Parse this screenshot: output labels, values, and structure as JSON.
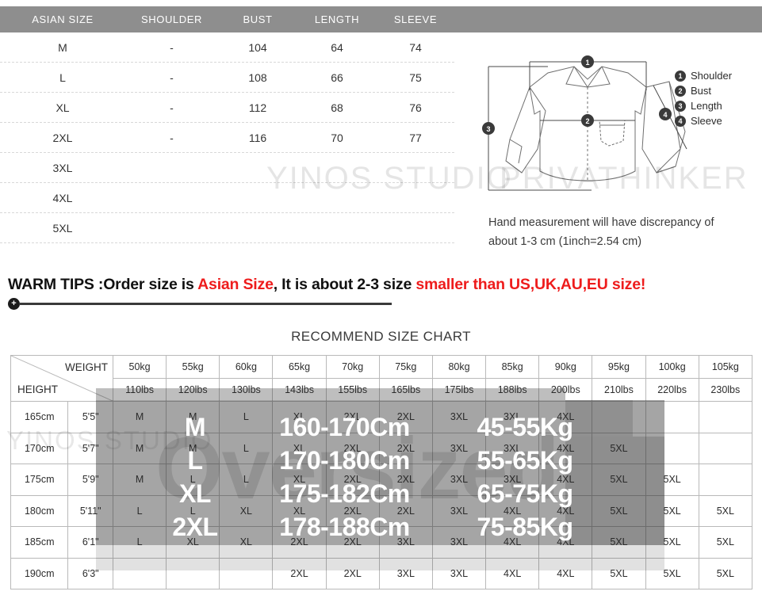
{
  "spec_table": {
    "headers": [
      "ASIAN SIZE",
      "SHOULDER",
      "BUST",
      "LENGTH",
      "SLEEVE"
    ],
    "rows": [
      {
        "size": "M",
        "shoulder": "-",
        "bust": "104",
        "length": "64",
        "sleeve": "74"
      },
      {
        "size": "L",
        "shoulder": "-",
        "bust": "108",
        "length": "66",
        "sleeve": "75"
      },
      {
        "size": "XL",
        "shoulder": "-",
        "bust": "112",
        "length": "68",
        "sleeve": "76"
      },
      {
        "size": "2XL",
        "shoulder": "-",
        "bust": "116",
        "length": "70",
        "sleeve": "77"
      },
      {
        "size": "3XL",
        "shoulder": "",
        "bust": "",
        "length": "",
        "sleeve": ""
      },
      {
        "size": "4XL",
        "shoulder": "",
        "bust": "",
        "length": "",
        "sleeve": ""
      },
      {
        "size": "5XL",
        "shoulder": "",
        "bust": "",
        "length": "",
        "sleeve": ""
      }
    ]
  },
  "diagram": {
    "legend": [
      {
        "num": "1",
        "label": "Shoulder"
      },
      {
        "num": "2",
        "label": "Bust"
      },
      {
        "num": "3",
        "label": "Length"
      },
      {
        "num": "4",
        "label": "Sleeve"
      }
    ],
    "markers": [
      "1",
      "2",
      "3",
      "4"
    ],
    "note_line1": "Hand measurement will have discrepancy of",
    "note_line2": "about 1-3 cm  (1inch=2.54 cm)"
  },
  "tips": {
    "p1": "WARM TIPS :Order size is ",
    "red1": "Asian Size",
    "p2": ", It is about 2-3 size ",
    "red2": "smaller than US,UK,AU,EU size!",
    "divider_symbol": "+"
  },
  "recommend": {
    "title": "RECOMMEND SIZE CHART",
    "corner_weight": "WEIGHT",
    "corner_height": "HEIGHT",
    "weight_kg": [
      "50kg",
      "55kg",
      "60kg",
      "65kg",
      "70kg",
      "75kg",
      "80kg",
      "85kg",
      "90kg",
      "95kg",
      "100kg",
      "105kg"
    ],
    "weight_lbs": [
      "110lbs",
      "120lbs",
      "130lbs",
      "143lbs",
      "155lbs",
      "165lbs",
      "175lbs",
      "188lbs",
      "200lbs",
      "210lbs",
      "220lbs",
      "230lbs"
    ],
    "rows": [
      {
        "cm": "165cm",
        "ft": "5'5\"",
        "sizes": [
          "M",
          "M",
          "L",
          "XL",
          "2XL",
          "2XL",
          "3XL",
          "3XL",
          "4XL",
          "",
          "",
          ""
        ]
      },
      {
        "cm": "170cm",
        "ft": "5'7\"",
        "sizes": [
          "M",
          "M",
          "L",
          "XL",
          "2XL",
          "2XL",
          "3XL",
          "3XL",
          "4XL",
          "5XL",
          "",
          ""
        ]
      },
      {
        "cm": "175cm",
        "ft": "5'9\"",
        "sizes": [
          "M",
          "L",
          "L",
          "XL",
          "2XL",
          "2XL",
          "3XL",
          "3XL",
          "4XL",
          "5XL",
          "5XL",
          ""
        ]
      },
      {
        "cm": "180cm",
        "ft": "5'11\"",
        "sizes": [
          "L",
          "L",
          "XL",
          "XL",
          "2XL",
          "2XL",
          "3XL",
          "4XL",
          "4XL",
          "5XL",
          "5XL",
          "5XL"
        ]
      },
      {
        "cm": "185cm",
        "ft": "6'1\"",
        "sizes": [
          "L",
          "XL",
          "XL",
          "2XL",
          "2XL",
          "3XL",
          "3XL",
          "4XL",
          "4XL",
          "5XL",
          "5XL",
          "5XL"
        ]
      },
      {
        "cm": "190cm",
        "ft": "6'3\"",
        "sizes": [
          "",
          "",
          "",
          "2XL",
          "2XL",
          "3XL",
          "3XL",
          "4XL",
          "4XL",
          "5XL",
          "5XL",
          "5XL"
        ]
      }
    ]
  },
  "overlay": {
    "rows": [
      {
        "size": "M",
        "height": "160-170Cm",
        "weight": "45-55Kg"
      },
      {
        "size": "L",
        "height": "170-180Cm",
        "weight": "55-65Kg"
      },
      {
        "size": "XL",
        "height": "175-182Cm",
        "weight": "65-75Kg"
      },
      {
        "size": "2XL",
        "height": "178-188Cm",
        "weight": "75-85Kg"
      }
    ]
  },
  "watermarks": {
    "top_left": "YINOS STUDIO",
    "top_right": "PRIVATHINKER",
    "bottom_small": "YINOS STUDIO",
    "bottom_large": "Oversized"
  },
  "colors": {
    "header_bar": "#8e8e8e",
    "accent_red": "#ee1c1c",
    "text_dark": "#2d2d2d",
    "grid_line": "#b9b9b9"
  }
}
